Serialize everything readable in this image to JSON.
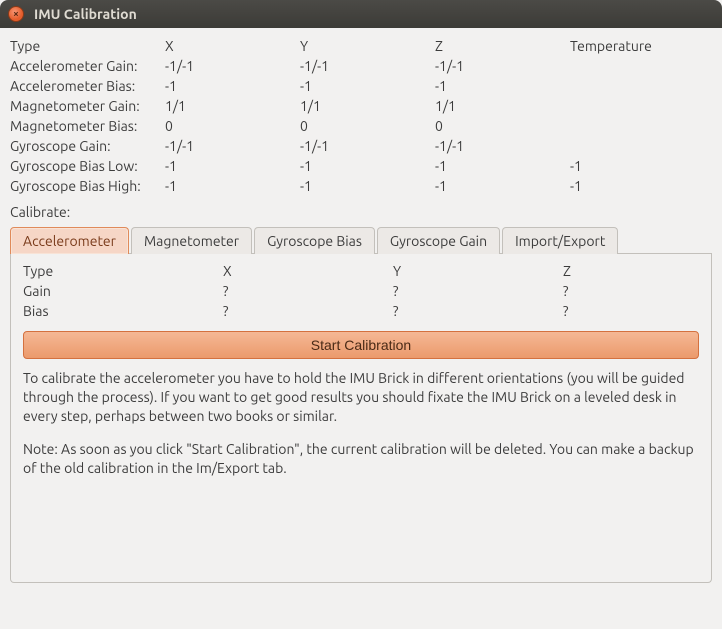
{
  "window": {
    "title": "IMU Calibration"
  },
  "top_headers": {
    "type": "Type",
    "x": "X",
    "y": "Y",
    "z": "Z",
    "temp": "Temperature"
  },
  "top_rows": {
    "accel_gain": {
      "label": "Accelerometer Gain:",
      "x": "-1/-1",
      "y": "-1/-1",
      "z": "-1/-1",
      "t": ""
    },
    "accel_bias": {
      "label": "Accelerometer Bias:",
      "x": "-1",
      "y": "-1",
      "z": "-1",
      "t": ""
    },
    "mag_gain": {
      "label": "Magnetometer Gain:",
      "x": "1/1",
      "y": "1/1",
      "z": "1/1",
      "t": ""
    },
    "mag_bias": {
      "label": "Magnetometer Bias:",
      "x": "0",
      "y": "0",
      "z": "0",
      "t": ""
    },
    "gyro_gain": {
      "label": "Gyroscope Gain:",
      "x": "-1/-1",
      "y": "-1/-1",
      "z": "-1/-1",
      "t": ""
    },
    "gyro_blo": {
      "label": "Gyroscope Bias Low:",
      "x": "-1",
      "y": "-1",
      "z": "-1",
      "t": "-1"
    },
    "gyro_bhi": {
      "label": "Gyroscope Bias High:",
      "x": "-1",
      "y": "-1",
      "z": "-1",
      "t": "-1"
    }
  },
  "calibrate_label": "Calibrate:",
  "tabs": {
    "accelerometer": "Accelerometer",
    "magnetometer": "Magnetometer",
    "gyro_bias": "Gyroscope Bias",
    "gyro_gain": "Gyroscope Gain",
    "import_export": "Import/Export"
  },
  "panel": {
    "headers": {
      "type": "Type",
      "x": "X",
      "y": "Y",
      "z": "Z"
    },
    "rows": {
      "gain": {
        "label": "Gain",
        "x": "?",
        "y": "?",
        "z": "?"
      },
      "bias": {
        "label": "Bias",
        "x": "?",
        "y": "?",
        "z": "?"
      }
    },
    "start_button": "Start Calibration",
    "para1": "To calibrate the accelerometer you have to hold the IMU Brick in different orientations (you will be guided through the process). If you want to get good results you should fixate the IMU Brick on a leveled desk in every step, perhaps between two books or similar.",
    "para2": "Note: As soon as you click \"Start Calibration\", the current calibration will be deleted. You can make a backup of the old calibration in the Im/Export tab."
  }
}
